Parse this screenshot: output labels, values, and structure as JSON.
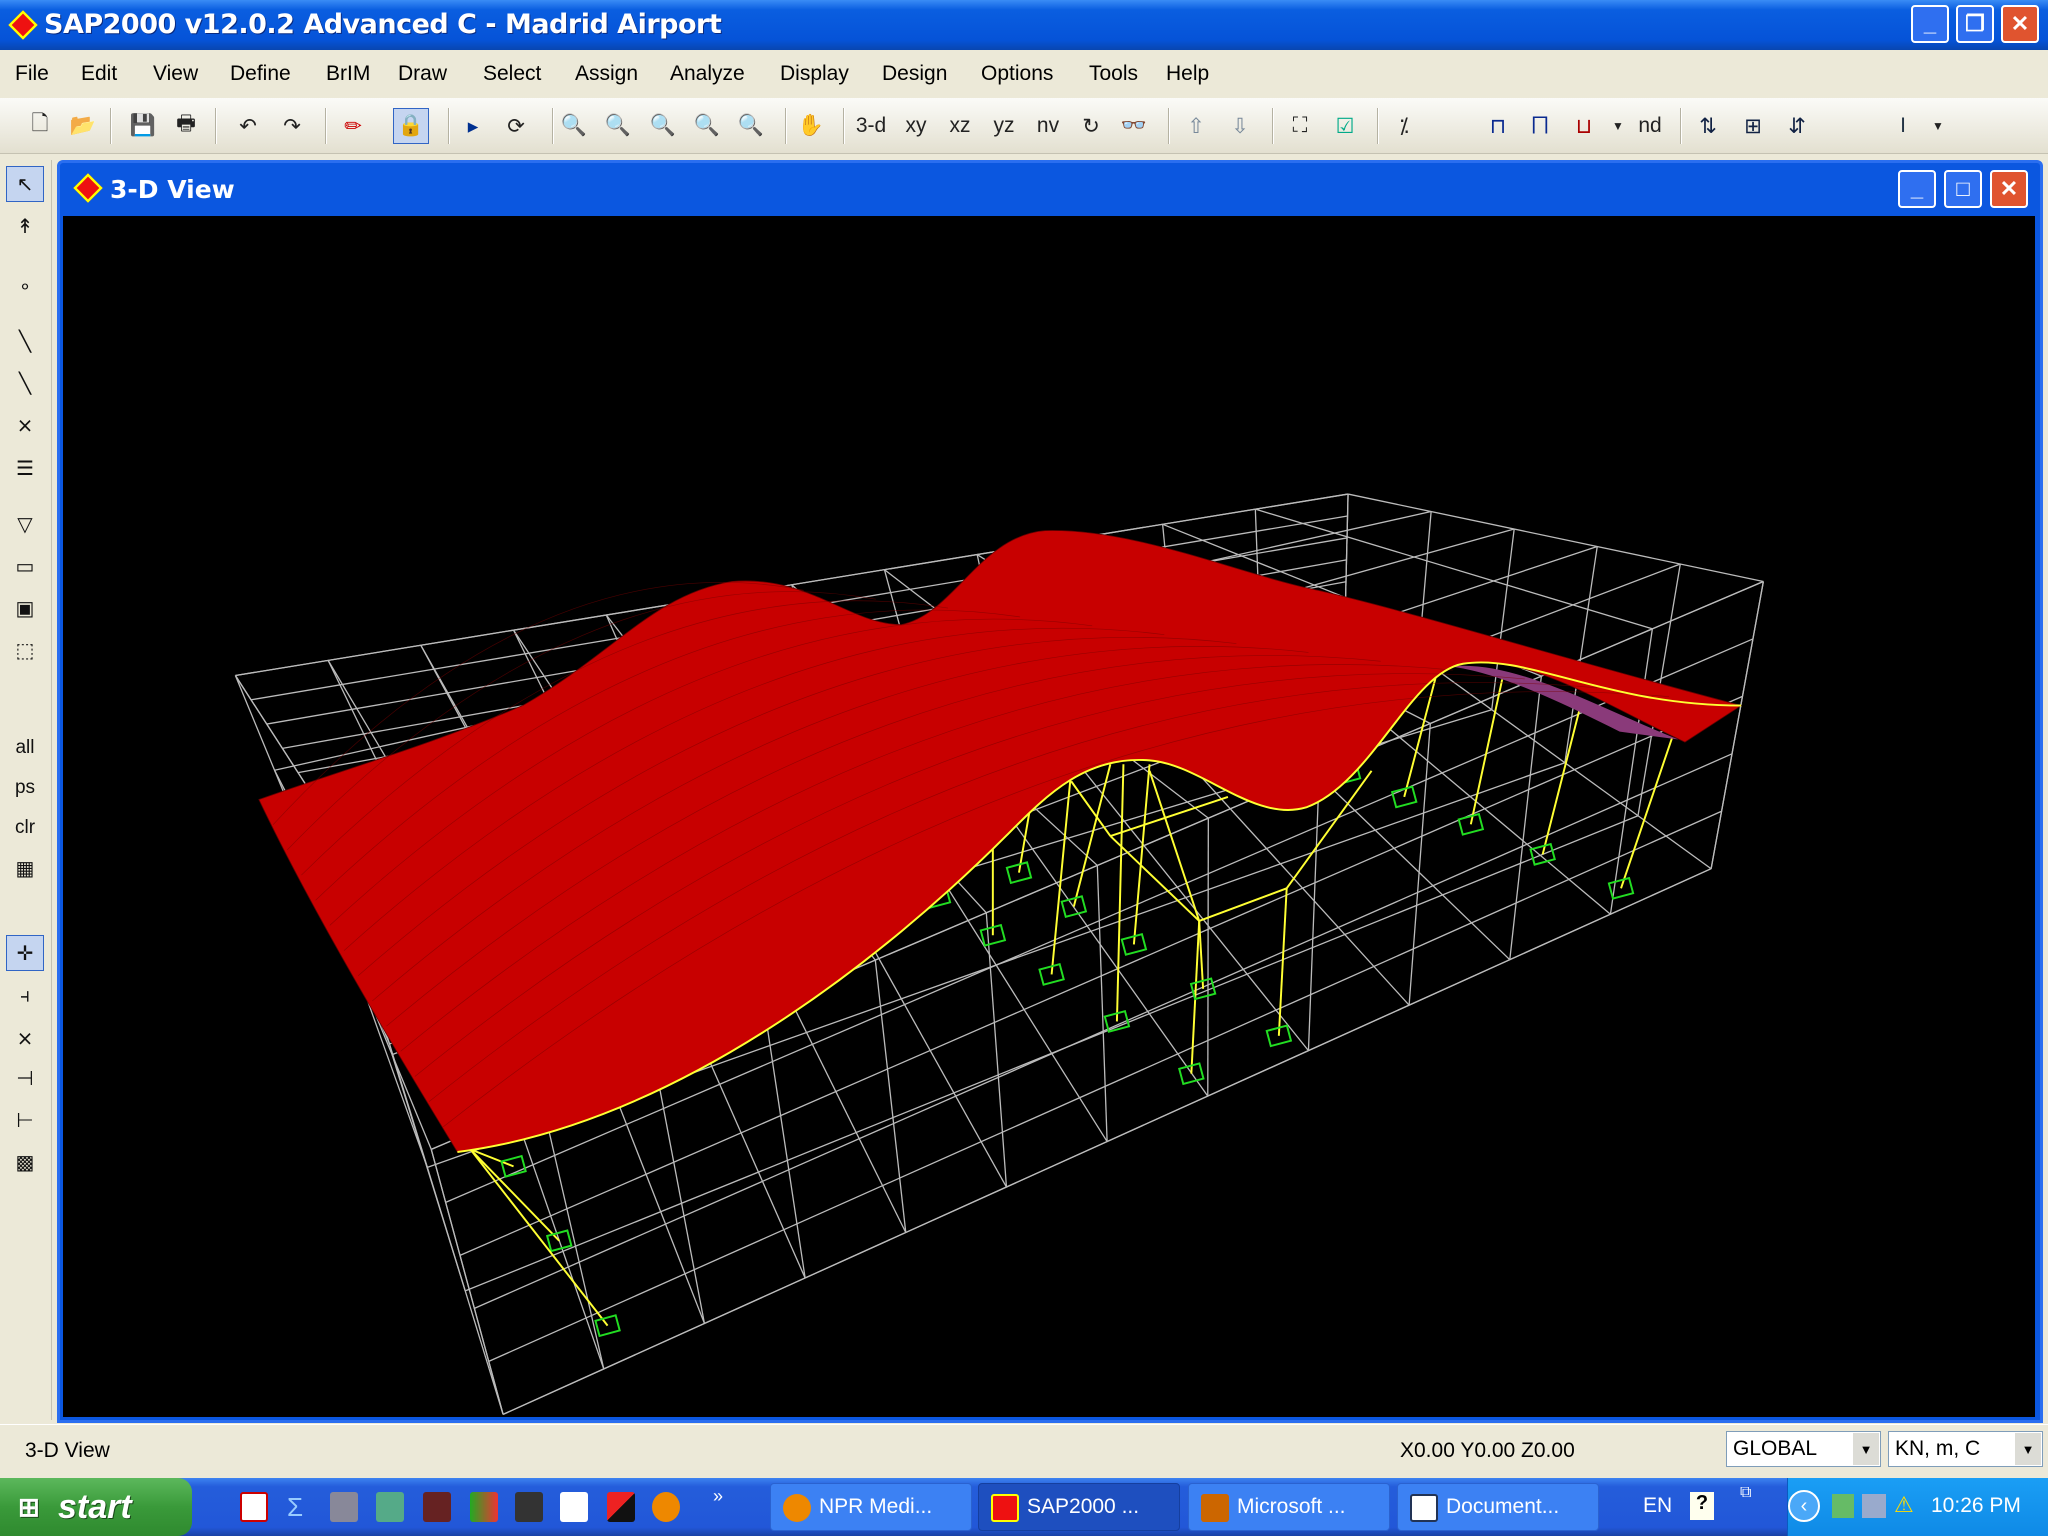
{
  "app": {
    "title": "SAP2000 v12.0.2 Advanced C  - Madrid Airport"
  },
  "menu": [
    "File",
    "Edit",
    "View",
    "Define",
    "BrIM",
    "Draw",
    "Select",
    "Assign",
    "Analyze",
    "Display",
    "Design",
    "Options",
    "Tools",
    "Help"
  ],
  "toolbar": {
    "view_3d": "3-d",
    "view_xy": "xy",
    "view_xz": "xz",
    "view_yz": "yz",
    "view_nv": "nv",
    "nd": "nd"
  },
  "left_toolbar": {
    "all": "all",
    "ps": "ps",
    "clr": "clr"
  },
  "child_window": {
    "title": "3-D View"
  },
  "status": {
    "view_name": "3-D View",
    "coordinates": "X0.00  Y0.00  Z0.00",
    "coord_system": "GLOBAL",
    "units": "KN, m, C"
  },
  "taskbar": {
    "start": "start",
    "tasks": [
      "NPR Medi...",
      "SAP2000 ...",
      "Microsoft ...",
      "Document..."
    ],
    "language": "EN",
    "clock": "10:26 PM"
  },
  "colors": {
    "surface": "#c80000",
    "frame": "#ffff33",
    "support": "#22dd22",
    "grid": "#bbbbbb"
  }
}
